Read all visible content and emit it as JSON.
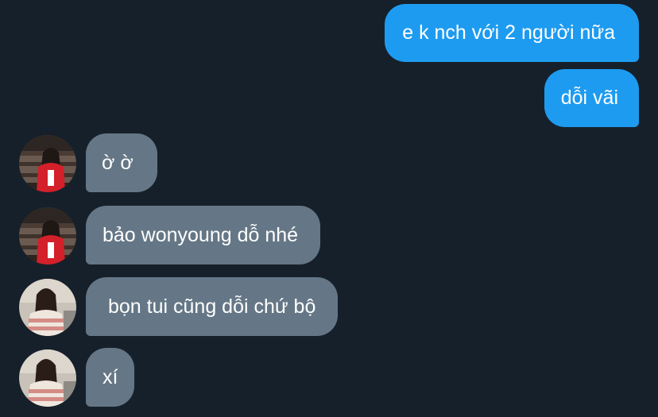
{
  "theme": {
    "background": "#16202b",
    "outgoing_bubble": "#1d9bf0",
    "incoming_bubble": "#657786",
    "text": "#ffffff"
  },
  "messages": [
    {
      "direction": "outgoing",
      "text": "e k nch với 2 người nữa"
    },
    {
      "direction": "outgoing",
      "text": "dỗi vãi"
    },
    {
      "direction": "incoming",
      "text": "ờ ờ",
      "avatar": "avatar-photo-red-outfit"
    },
    {
      "direction": "incoming",
      "text": "bảo wonyoung dỗ nhé",
      "avatar": "avatar-photo-red-outfit"
    },
    {
      "direction": "incoming",
      "text": "bọn tui cũng dỗi chứ bộ",
      "avatar": "avatar-photo-striped-sweater"
    },
    {
      "direction": "incoming",
      "text": "xí",
      "avatar": "avatar-photo-striped-sweater"
    }
  ]
}
